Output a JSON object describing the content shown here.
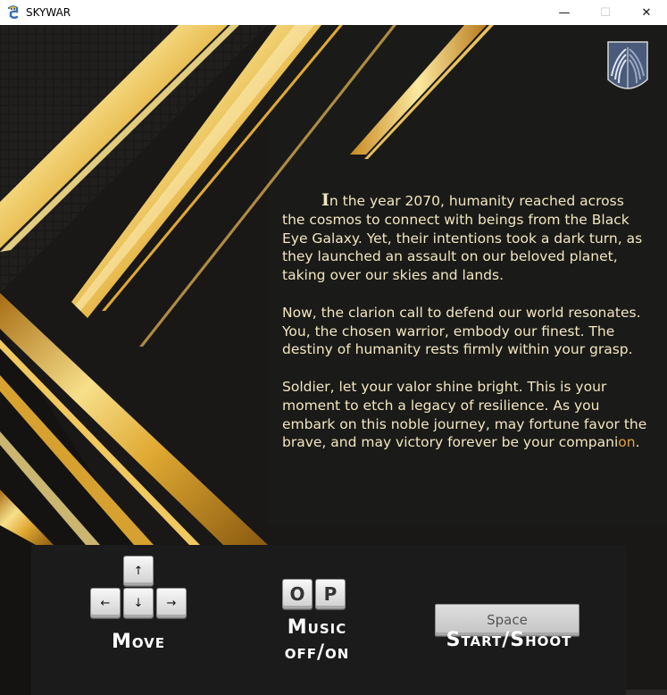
{
  "window": {
    "title": "SKYWAR",
    "icon": "pygame-snake-icon",
    "controls": {
      "minimize": "—",
      "maximize": "☐",
      "close": "✕"
    }
  },
  "emblem": {
    "icon": "wings-of-freedom-emblem"
  },
  "story": {
    "p1_first_letter": "I",
    "p1_rest": "n the year 2070, humanity reached across the cosmos to connect with beings from the Black Eye Galaxy. Yet, their intentions took a dark turn, as they launched an assault on our beloved planet, taking over our skies and lands.",
    "p2": "Now, the clarion call to defend our world resonates. You, the chosen warrior, embody our finest. The destiny of humanity rests firmly within your grasp.",
    "p3_main": "Soldier, let your valor shine bright. This is your moment to etch a legacy of resilience. As you embark on this noble journey, may fortune favor the brave, and may victory forever be your compani",
    "p3_highlight": "on",
    "p3_end": "."
  },
  "controls": {
    "move": {
      "keys": {
        "up": "↑",
        "left": "←",
        "down": "↓",
        "right": "→"
      },
      "label": "Move"
    },
    "music": {
      "keys": [
        "O",
        "P"
      ],
      "label_line1": "Music",
      "label_line2": "off/on"
    },
    "shoot": {
      "key": "Space",
      "label": "Start/Shoot"
    }
  },
  "colors": {
    "background": "#191817",
    "gold_light": "#f7df8a",
    "gold_mid": "#e0a932",
    "gold_dark": "#a86e14",
    "story_text": "#f2e6c0",
    "highlight": "#e3a23c"
  }
}
